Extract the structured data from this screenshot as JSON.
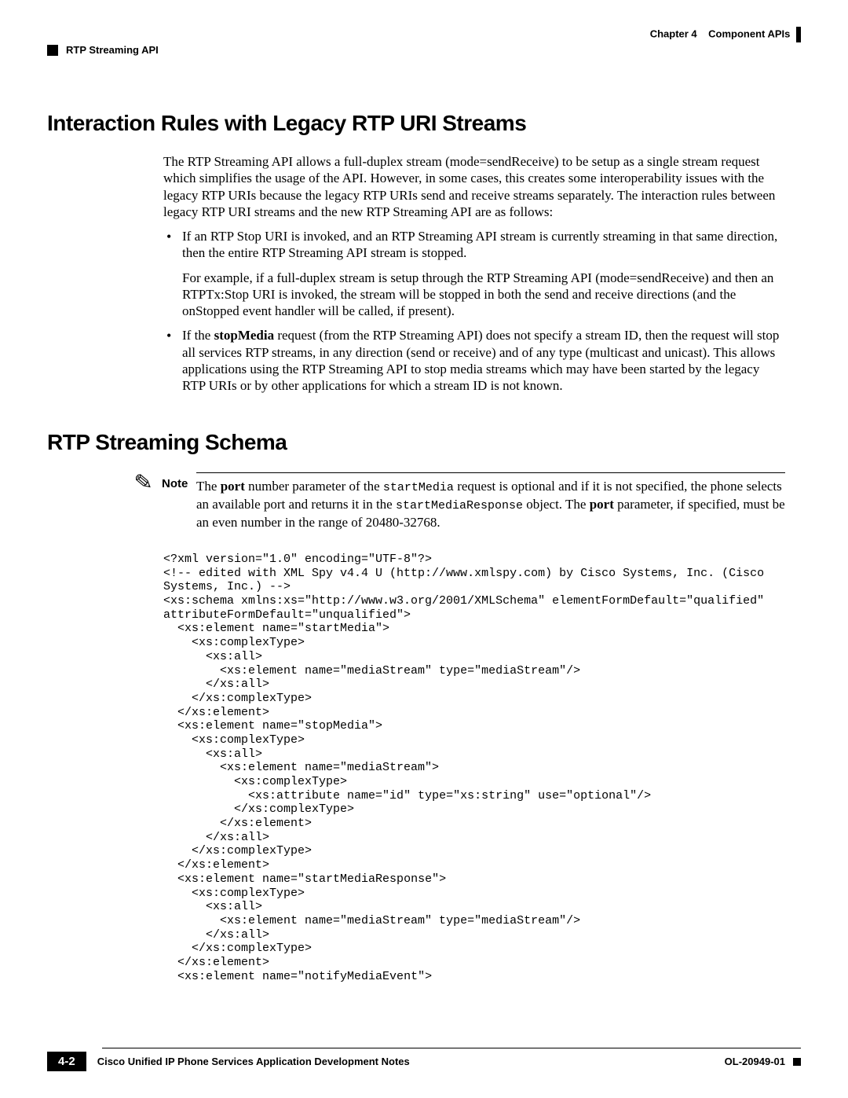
{
  "header": {
    "chapter_label": "Chapter 4",
    "chapter_title": "Component APIs",
    "left_title": "RTP Streaming API"
  },
  "section1": {
    "heading": "Interaction Rules with Legacy RTP URI Streams",
    "intro": "The RTP Streaming API allows a full-duplex stream (mode=sendReceive) to be setup as a single stream request which simplifies the usage of the API. However, in some cases, this creates some interoperability issues with the legacy RTP URIs because the legacy RTP URIs send and receive streams separately. The interaction rules between legacy RTP URI streams and the new RTP Streaming API are as follows:",
    "bullet1a": "If an RTP Stop URI is invoked, and an RTP Streaming API stream is currently streaming in that same direction, then the entire RTP Streaming API stream is stopped.",
    "bullet1b": "For example, if a full-duplex stream is setup through the RTP Streaming API (mode=sendReceive) and then an RTPTx:Stop URI is invoked, the stream will be stopped in both the send and receive directions (and the onStopped event handler will be called, if present).",
    "bullet2_pre": "If the ",
    "bullet2_bold": "stopMedia",
    "bullet2_post": " request (from the RTP Streaming API) does not specify a stream ID, then the request will stop all services RTP streams, in any direction (send or receive) and of any type (multicast and unicast). This allows applications using the RTP Streaming API to stop media streams which may have been started by the legacy RTP URIs or by other applications for which a stream ID is not known."
  },
  "section2": {
    "heading": "RTP Streaming Schema",
    "note_label": "Note",
    "note_a": "The ",
    "note_b_port": "port",
    "note_c": " number parameter of the ",
    "note_code1": "startMedia",
    "note_d": " request is optional and if it is not specified, the phone selects an available port and returns it in the ",
    "note_code2": "startMediaResponse",
    "note_e": " object. The ",
    "note_b_port2": "port",
    "note_f": " parameter, if specified, must be an even number in the range of 20480-32768."
  },
  "schema_code": "<?xml version=\"1.0\" encoding=\"UTF-8\"?>\n<!-- edited with XML Spy v4.4 U (http://www.xmlspy.com) by Cisco Systems, Inc. (Cisco Systems, Inc.) -->\n<xs:schema xmlns:xs=\"http://www.w3.org/2001/XMLSchema\" elementFormDefault=\"qualified\" attributeFormDefault=\"unqualified\">\n  <xs:element name=\"startMedia\">\n    <xs:complexType>\n      <xs:all>\n        <xs:element name=\"mediaStream\" type=\"mediaStream\"/>\n      </xs:all>\n    </xs:complexType>\n  </xs:element>\n  <xs:element name=\"stopMedia\">\n    <xs:complexType>\n      <xs:all>\n        <xs:element name=\"mediaStream\">\n          <xs:complexType>\n            <xs:attribute name=\"id\" type=\"xs:string\" use=\"optional\"/>\n          </xs:complexType>\n        </xs:element>\n      </xs:all>\n    </xs:complexType>\n  </xs:element>\n  <xs:element name=\"startMediaResponse\">\n    <xs:complexType>\n      <xs:all>\n        <xs:element name=\"mediaStream\" type=\"mediaStream\"/>\n      </xs:all>\n    </xs:complexType>\n  </xs:element>\n  <xs:element name=\"notifyMediaEvent\">",
  "footer": {
    "page_num": "4-2",
    "doc_title": "Cisco Unified IP Phone Services Application Development Notes",
    "doc_id": "OL-20949-01"
  }
}
